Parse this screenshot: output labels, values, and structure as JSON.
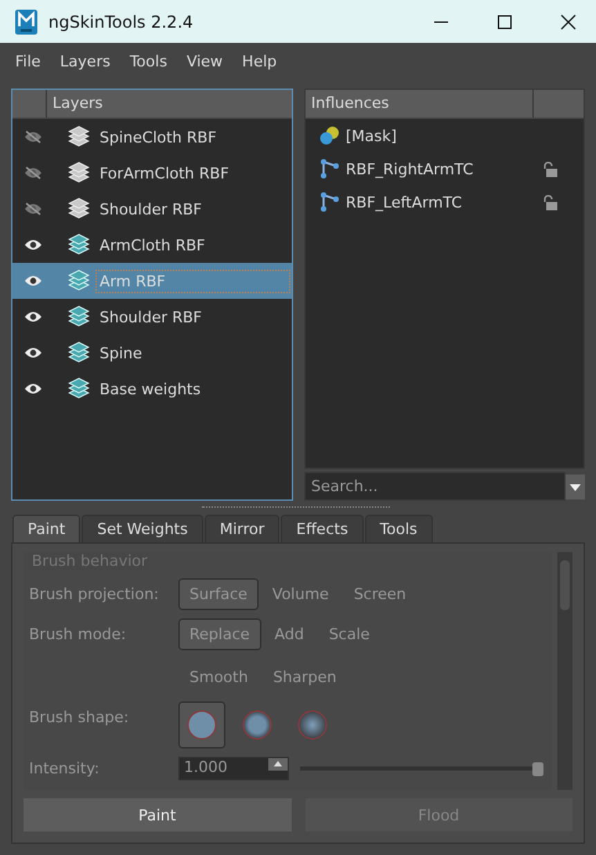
{
  "window": {
    "title": "ngSkinTools 2.2.4"
  },
  "menu": [
    "File",
    "Layers",
    "Tools",
    "View",
    "Help"
  ],
  "layers": {
    "heading": "Layers",
    "items": [
      {
        "name": "SpineCloth RBF",
        "visible": false,
        "selected": false
      },
      {
        "name": "ForArmCloth RBF",
        "visible": false,
        "selected": false
      },
      {
        "name": "Shoulder RBF",
        "visible": false,
        "selected": false
      },
      {
        "name": "ArmCloth RBF",
        "visible": true,
        "selected": false
      },
      {
        "name": "Arm RBF",
        "visible": true,
        "selected": true
      },
      {
        "name": "Shoulder RBF",
        "visible": true,
        "selected": false
      },
      {
        "name": "Spine",
        "visible": true,
        "selected": false
      },
      {
        "name": "Base weights",
        "visible": true,
        "selected": false
      }
    ]
  },
  "influences": {
    "heading": "Influences",
    "items": [
      {
        "name": "[Mask]",
        "kind": "mask"
      },
      {
        "name": "RBF_RightArmTC",
        "kind": "joint",
        "locked": false
      },
      {
        "name": "RBF_LeftArmTC",
        "kind": "joint",
        "locked": false
      }
    ],
    "search": {
      "placeholder": "Search..."
    }
  },
  "tabs": [
    {
      "label": "Paint",
      "selected": true
    },
    {
      "label": "Set Weights",
      "selected": false
    },
    {
      "label": "Mirror",
      "selected": false
    },
    {
      "label": "Effects",
      "selected": false
    },
    {
      "label": "Tools",
      "selected": false
    }
  ],
  "brush_behavior": {
    "title": "Brush behavior",
    "projection": {
      "label": "Brush projection:",
      "options": [
        {
          "label": "Surface",
          "selected": true
        },
        {
          "label": "Volume",
          "selected": false
        },
        {
          "label": "Screen",
          "selected": false
        }
      ]
    },
    "mode": {
      "label": "Brush mode:",
      "options": [
        {
          "label": "Replace",
          "selected": true
        },
        {
          "label": "Add",
          "selected": false
        },
        {
          "label": "Scale",
          "selected": false
        },
        {
          "label": "Smooth",
          "selected": false
        },
        {
          "label": "Sharpen",
          "selected": false
        }
      ]
    },
    "shape": {
      "label": "Brush shape:",
      "options": [
        {
          "kind": "solid",
          "selected": true
        },
        {
          "kind": "soft",
          "selected": false
        },
        {
          "kind": "gaussian",
          "selected": false
        }
      ]
    },
    "intensity": {
      "label": "Intensity:",
      "value": "1.000",
      "level": 1.0
    }
  },
  "buttons": [
    {
      "label": "Paint",
      "disabled": false
    },
    {
      "label": "Flood",
      "disabled": true
    }
  ]
}
